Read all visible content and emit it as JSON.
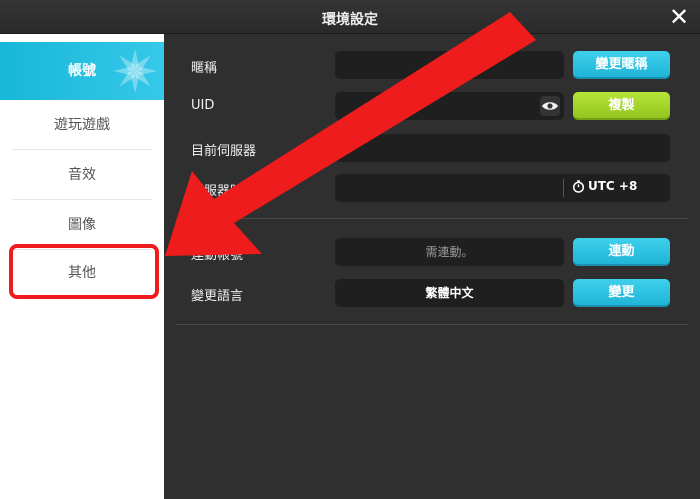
{
  "window": {
    "title": "環境設定",
    "close_glyph": "✕"
  },
  "sidebar": {
    "items": [
      {
        "label": "帳號",
        "active": true
      },
      {
        "label": "遊玩遊戲"
      },
      {
        "label": "音效"
      },
      {
        "label": "圖像"
      },
      {
        "label": "其他"
      }
    ]
  },
  "account": {
    "nickname": {
      "label": "暱稱",
      "value": "",
      "button": "變更暱稱"
    },
    "uid": {
      "label": "UID",
      "value": "",
      "button": "複製"
    },
    "current_server": {
      "label": "目前伺服器",
      "value": ""
    },
    "server_time": {
      "label": "伺服器時間",
      "value": "",
      "timezone": "UTC +8"
    },
    "link_account": {
      "label": "連動帳號",
      "placeholder": "需連動。",
      "button": "連動"
    },
    "language": {
      "label": "變更語言",
      "value": "繁體中文",
      "button": "變更"
    }
  },
  "colors": {
    "accent": "#1eb2d6",
    "copy": "#8fc41c",
    "annotation": "#ee1c1c"
  }
}
